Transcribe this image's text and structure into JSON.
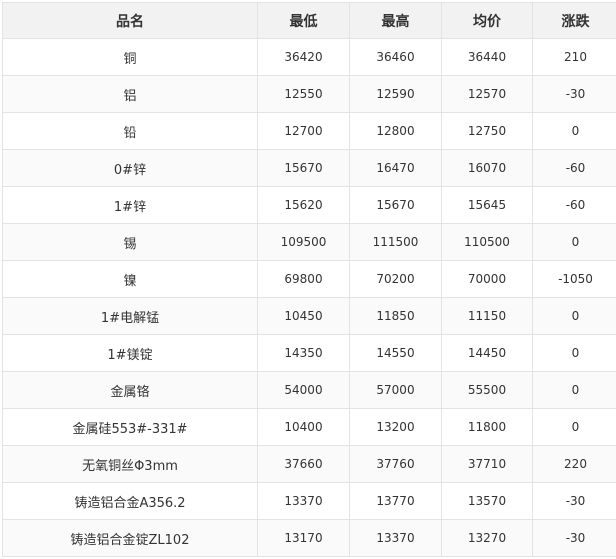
{
  "table": {
    "headers": [
      "品名",
      "最低",
      "最高",
      "均价",
      "涨跌"
    ],
    "rows": [
      [
        "铜",
        "36420",
        "36460",
        "36440",
        "210"
      ],
      [
        "铝",
        "12550",
        "12590",
        "12570",
        "-30"
      ],
      [
        "铅",
        "12700",
        "12800",
        "12750",
        "0"
      ],
      [
        "0#锌",
        "15670",
        "16470",
        "16070",
        "-60"
      ],
      [
        "1#锌",
        "15620",
        "15670",
        "15645",
        "-60"
      ],
      [
        "锡",
        "109500",
        "111500",
        "110500",
        "0"
      ],
      [
        "镍",
        "69800",
        "70200",
        "70000",
        "-1050"
      ],
      [
        "1#电解锰",
        "10450",
        "11850",
        "11150",
        "0"
      ],
      [
        "1#镁锭",
        "14350",
        "14550",
        "14450",
        "0"
      ],
      [
        "金属铬",
        "54000",
        "57000",
        "55500",
        "0"
      ],
      [
        "金属硅553#-331#",
        "10400",
        "13200",
        "11800",
        "0"
      ],
      [
        "无氧铜丝Φ3mm",
        "37660",
        "37760",
        "37710",
        "220"
      ],
      [
        "铸造铝合金A356.2",
        "13370",
        "13770",
        "13570",
        "-30"
      ],
      [
        "铸造铝合金锭ZL102",
        "13170",
        "13370",
        "13270",
        "-30"
      ]
    ]
  }
}
